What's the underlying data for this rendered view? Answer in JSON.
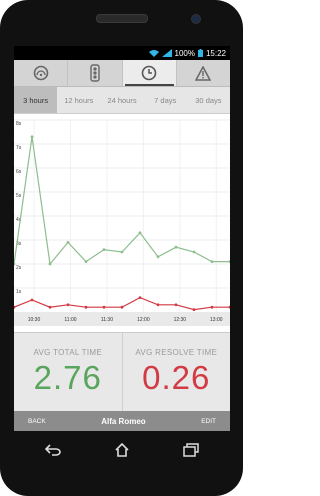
{
  "status": {
    "battery": "100%",
    "time": "15:22"
  },
  "toolbar": {
    "items": [
      {
        "icon": "gauge-icon"
      },
      {
        "icon": "traffic-light-icon"
      },
      {
        "icon": "clock-icon",
        "selected": true
      },
      {
        "icon": "warning-icon"
      }
    ]
  },
  "tabs": [
    "3 hours",
    "12 hours",
    "24 hours",
    "7 days",
    "30 days"
  ],
  "active_tab": "3 hours",
  "chart_data": {
    "type": "line",
    "y_ticks": [
      "8s",
      "7s",
      "6s",
      "5s",
      "4s",
      "3s",
      "2s",
      "1s"
    ],
    "ylim": [
      0,
      8
    ],
    "x_ticks": [
      "10:30",
      "11:00",
      "11:30",
      "12:00",
      "12:30",
      "13:00"
    ],
    "series": [
      {
        "color": "#8ebd8e",
        "values": [
          2.0,
          7.3,
          2.0,
          2.9,
          2.1,
          2.6,
          2.5,
          3.3,
          2.3,
          2.7,
          2.5,
          2.1,
          2.1
        ]
      },
      {
        "color": "#d23a44",
        "values": [
          0.2,
          0.5,
          0.2,
          0.3,
          0.2,
          0.2,
          0.2,
          0.6,
          0.3,
          0.3,
          0.1,
          0.2,
          0.2
        ]
      }
    ]
  },
  "stats": {
    "avg_total_label": "AVG TOTAL TIME",
    "avg_total_value": "2.76",
    "avg_total_color": "#5aa55d",
    "avg_resolve_label": "AVG RESOLVE TIME",
    "avg_resolve_value": "0.26",
    "avg_resolve_color": "#d23a44"
  },
  "bottom": {
    "back": "BACK",
    "title": "Alfa Romeo",
    "edit": "EDIT"
  },
  "nav": [
    {
      "icon": "back-icon"
    },
    {
      "icon": "home-icon"
    },
    {
      "icon": "recent-apps-icon"
    }
  ]
}
